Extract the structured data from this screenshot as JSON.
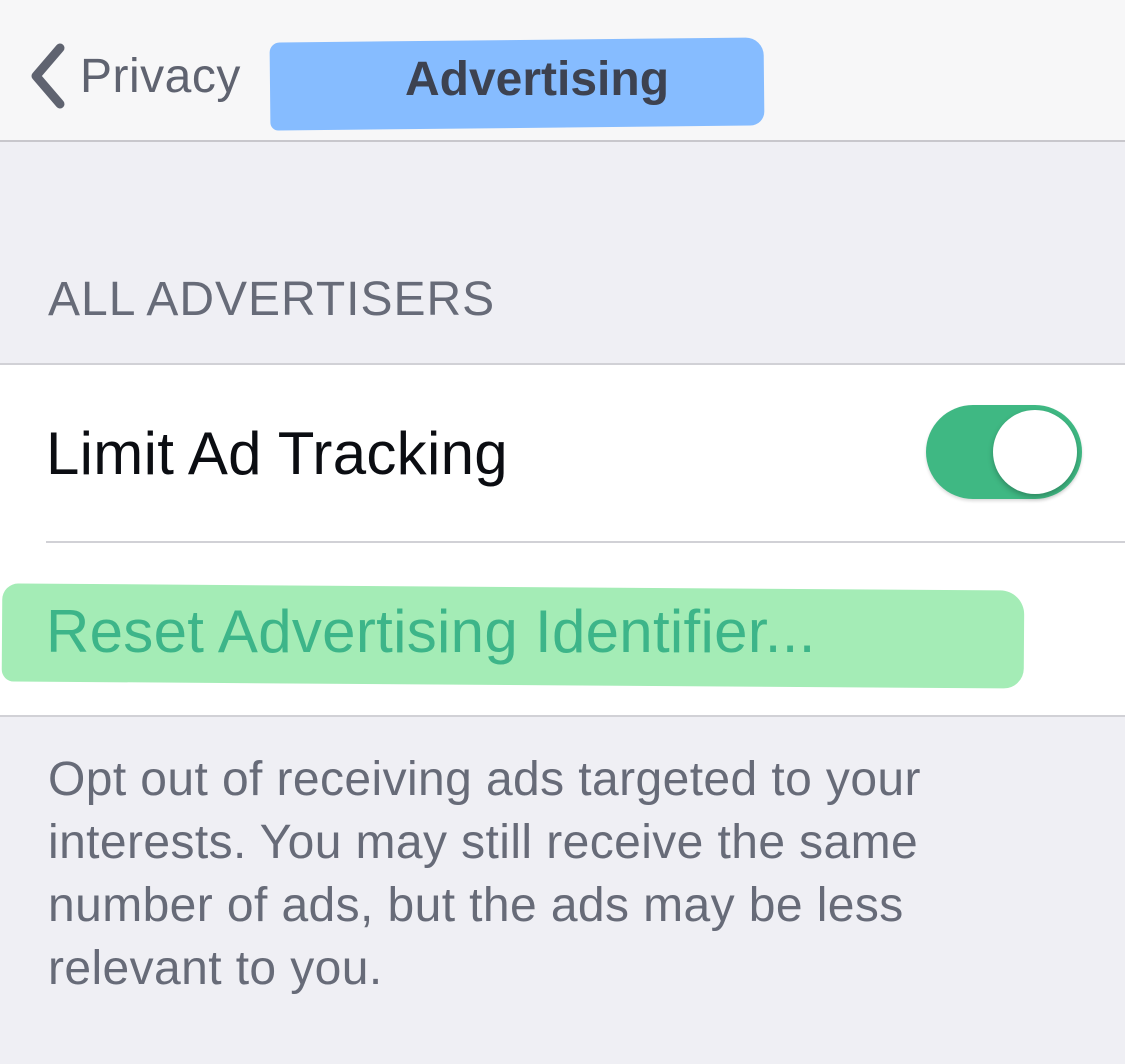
{
  "navbar": {
    "back_label": "Privacy",
    "title": "Advertising"
  },
  "section": {
    "header": "ALL ADVERTISERS"
  },
  "settings": {
    "limit_ad_tracking": {
      "label": "Limit Ad Tracking",
      "enabled": true
    },
    "reset_identifier_label": "Reset Advertising Identifier..."
  },
  "footer": {
    "text": "Opt out of receiving ads targeted to your interests. You may still receive the same number of ads, but the ads may be less relevant to you."
  },
  "colors": {
    "toggle_on": "#3fb883",
    "title_highlight": "#7fb8ff",
    "reset_highlight": "#a4ecb6",
    "reset_text": "#3db589"
  },
  "icons": {
    "back": "chevron-left-icon"
  }
}
